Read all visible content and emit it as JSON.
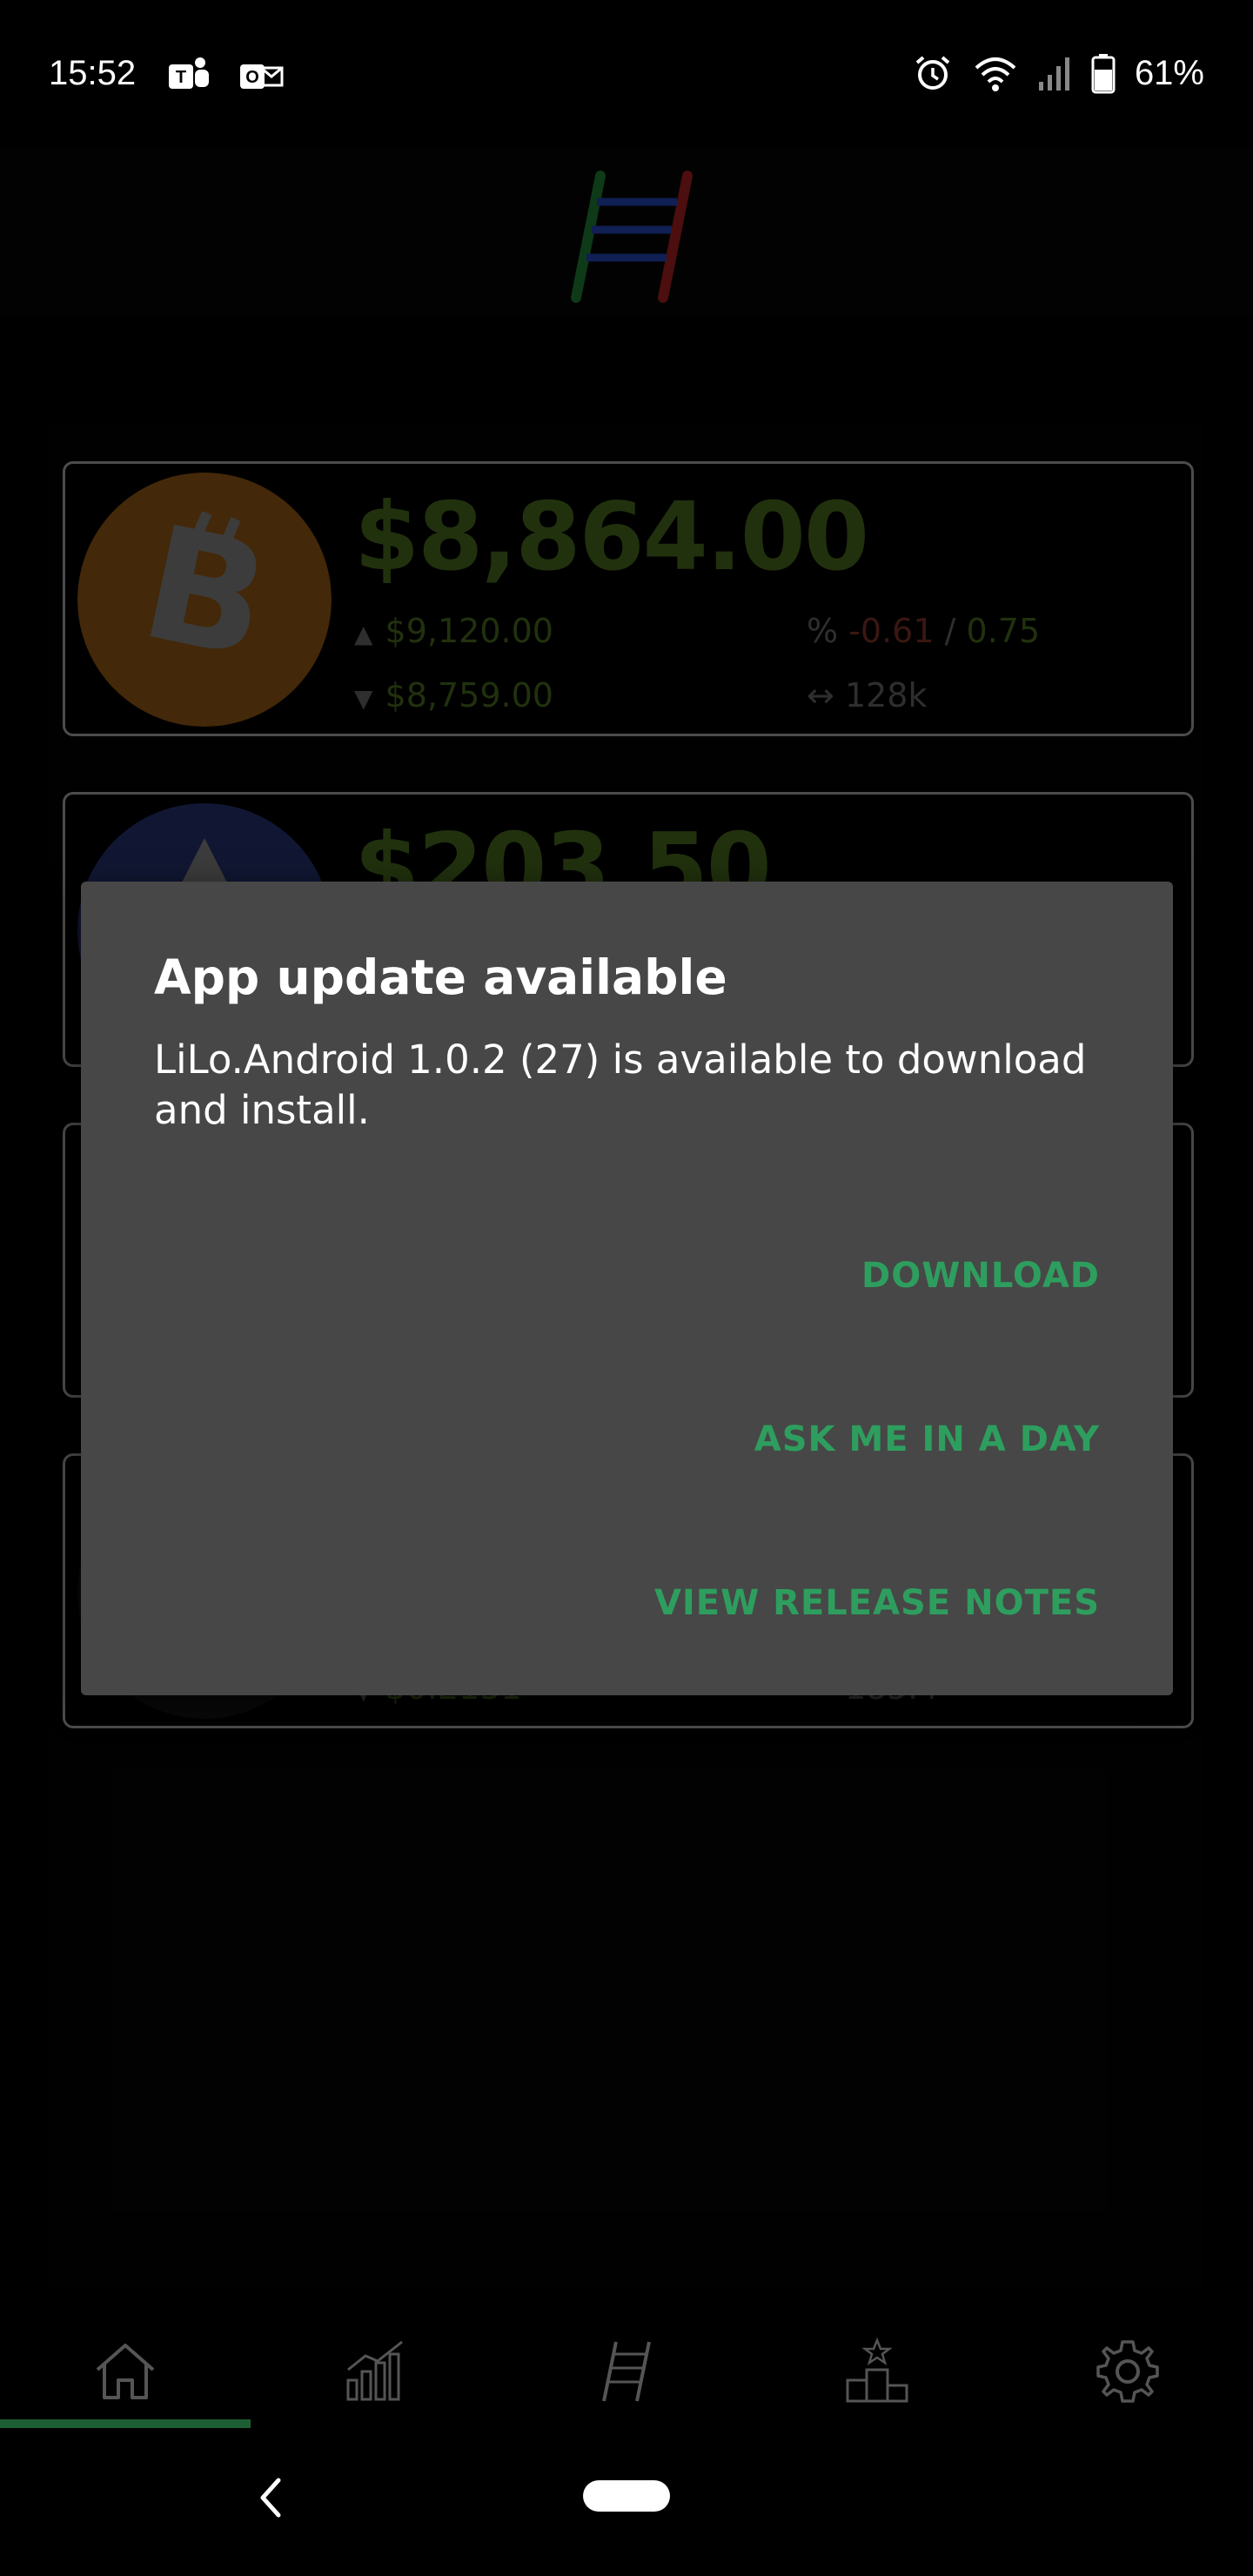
{
  "status_bar": {
    "time": "15:52",
    "battery_percent": "61%",
    "left_icons": [
      "teams-icon",
      "outlook-icon"
    ],
    "right_icons": [
      "alarm-icon",
      "wifi-icon",
      "signal-icon",
      "battery-icon"
    ]
  },
  "header": {
    "logo": "ladder-logo"
  },
  "coins": [
    {
      "name_icon": "bitcoin-icon",
      "price": "$8,864.00",
      "high": "$9,120.00",
      "low": "$8,759.00",
      "change_neg": "-0.61",
      "change_sep": "/",
      "change_pos": "0.75",
      "volume": "128k",
      "percent_symbol": "%",
      "volume_symbol": "↔"
    },
    {
      "name_icon": "ethereum-icon",
      "price": "$203.50"
    },
    {
      "name_icon": "coin-icon"
    },
    {
      "name_icon": "coin-icon",
      "low": "$0.2131",
      "volume": "185M"
    }
  ],
  "dialog": {
    "title": "App update available",
    "message": "LiLo.Android 1.0.2 (27) is available to download and install.",
    "buttons": {
      "download": "DOWNLOAD",
      "ask_later": "ASK ME IN A DAY",
      "release_notes": "VIEW RELEASE NOTES"
    },
    "accent_color": "#2e9e5e"
  },
  "bottom_nav": {
    "items": [
      "home-icon",
      "chart-icon",
      "ladder-icon",
      "leaderboard-icon",
      "settings-icon"
    ],
    "active_index": 0
  },
  "colors": {
    "price_green": "#3d5a1a",
    "negative_red": "#6a2a22",
    "dialog_bg": "#474747"
  }
}
